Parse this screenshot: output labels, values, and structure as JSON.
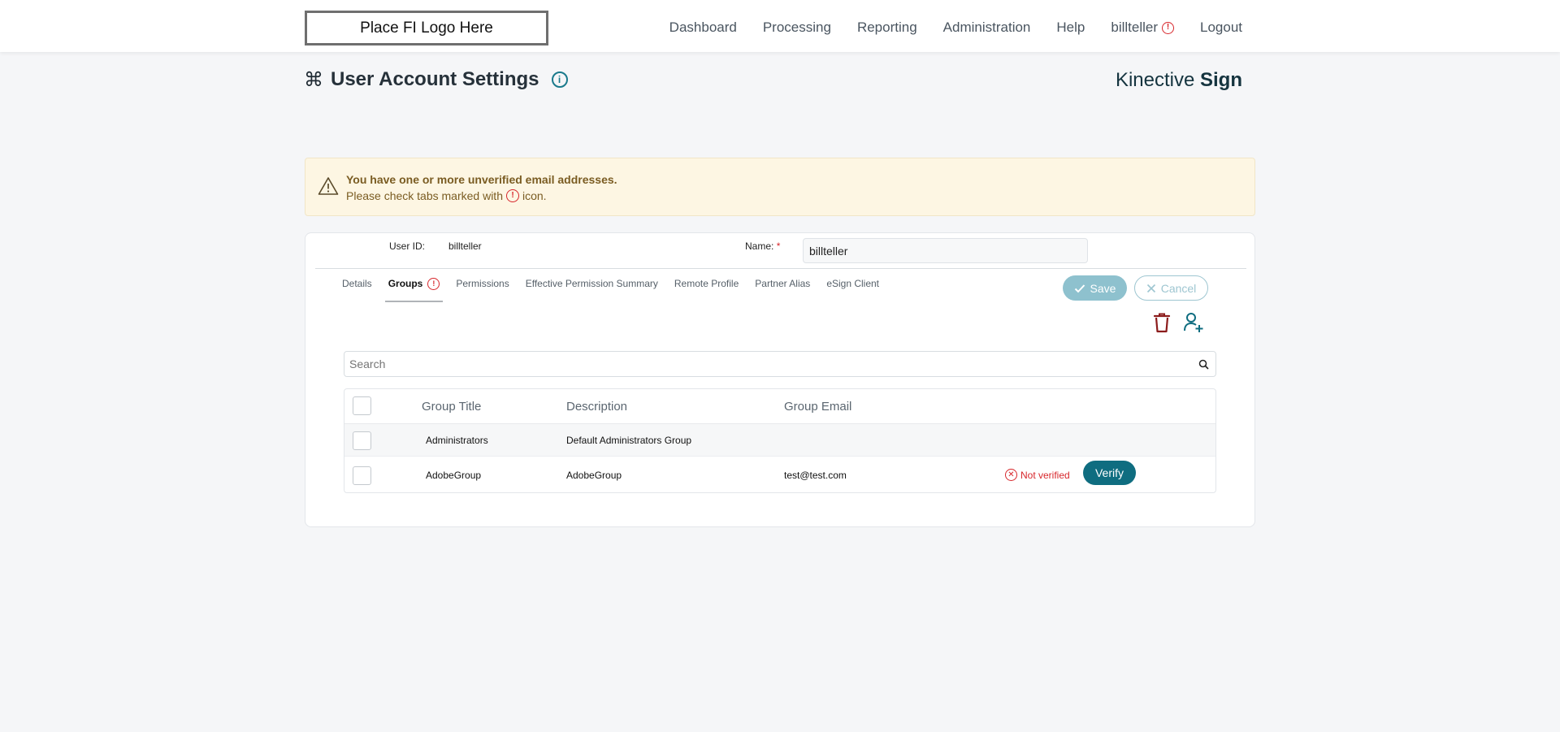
{
  "header": {
    "logo_text": "Place FI Logo Here",
    "nav": {
      "dashboard": "Dashboard",
      "processing": "Processing",
      "reporting": "Reporting",
      "administration": "Administration",
      "help": "Help",
      "user": "billteller",
      "logout": "Logout"
    }
  },
  "page": {
    "title": "User Account Settings",
    "brand_regular": "Kinective ",
    "brand_bold": "Sign"
  },
  "alert": {
    "title": "You have one or more unverified email addresses.",
    "body_before": "Please check tabs marked with",
    "body_after": "icon."
  },
  "form": {
    "user_id_label": "User ID:",
    "user_id_value": "billteller",
    "name_label": "Name:",
    "name_required": "*",
    "name_value": "billteller"
  },
  "tabs": {
    "details": "Details",
    "groups": "Groups",
    "permissions": "Permissions",
    "effective": "Effective Permission Summary",
    "remote": "Remote Profile",
    "partner": "Partner Alias",
    "esign": "eSign Client"
  },
  "actions": {
    "save": "Save",
    "cancel": "Cancel"
  },
  "search": {
    "placeholder": "Search"
  },
  "table": {
    "headers": {
      "title": "Group Title",
      "description": "Description",
      "email": "Group Email"
    },
    "rows": [
      {
        "title": "Administrators",
        "description": "Default Administrators Group",
        "email": ""
      },
      {
        "title": "AdobeGroup",
        "description": "AdobeGroup",
        "email": "test@test.com",
        "status": "Not verified",
        "action": "Verify"
      }
    ]
  },
  "colors": {
    "accent": "#0f6d80",
    "error": "#d7262b",
    "alert_bg": "#fdf6e3"
  }
}
